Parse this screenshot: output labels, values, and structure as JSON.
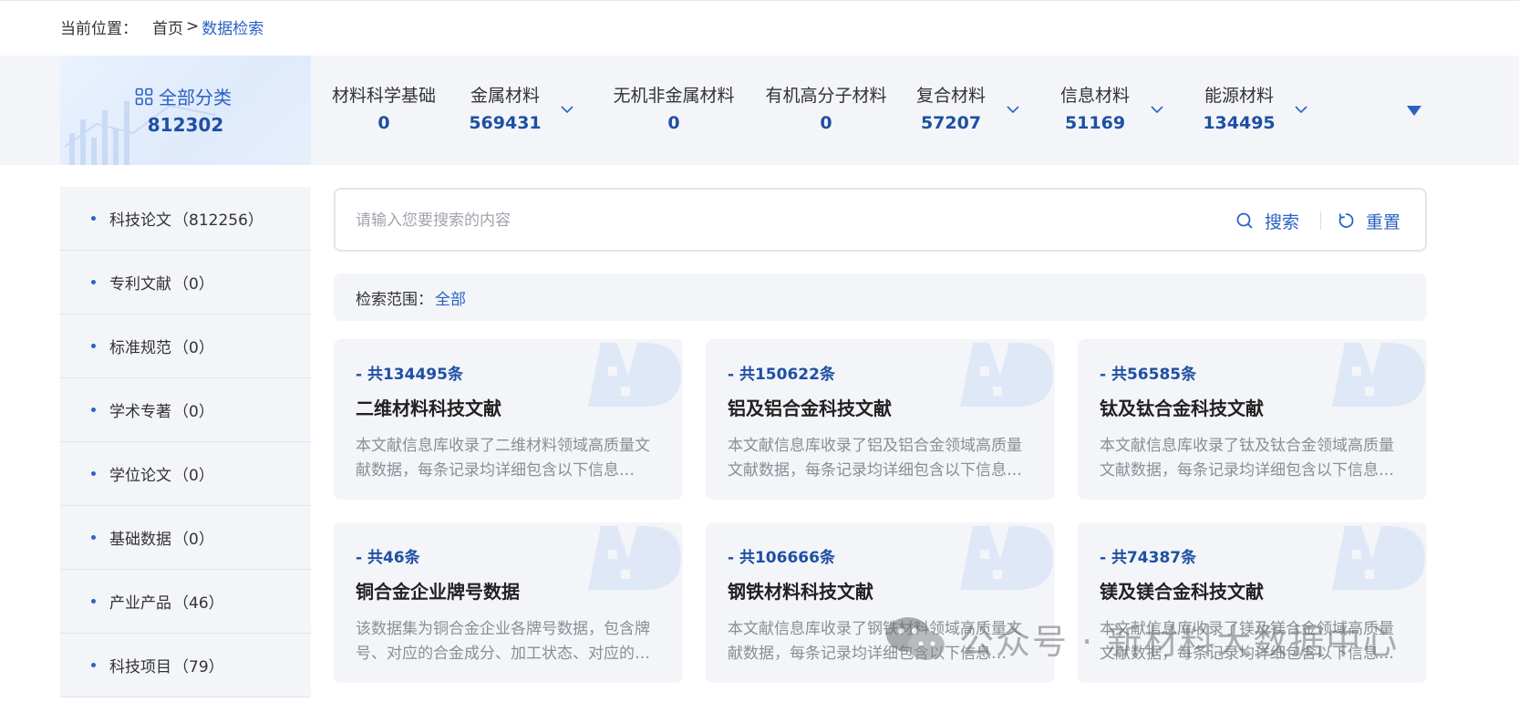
{
  "breadcrumb": {
    "prefix": "当前位置：",
    "home": "首页",
    "sep": ">",
    "current": "数据检索"
  },
  "all_category": {
    "label": "全部分类",
    "count": "812302"
  },
  "categories": [
    {
      "name": "材料科学基础",
      "count": "0",
      "has_dropdown": false
    },
    {
      "name": "金属材料",
      "count": "569431",
      "has_dropdown": true
    },
    {
      "name": "无机非金属材料",
      "count": "0",
      "has_dropdown": false
    },
    {
      "name": "有机高分子材料",
      "count": "0",
      "has_dropdown": false
    },
    {
      "name": "复合材料",
      "count": "57207",
      "has_dropdown": true
    },
    {
      "name": "信息材料",
      "count": "51169",
      "has_dropdown": true
    },
    {
      "name": "能源材料",
      "count": "134495",
      "has_dropdown": true
    }
  ],
  "sidebar": {
    "items": [
      {
        "label": "科技论文",
        "count": "（812256）"
      },
      {
        "label": "专利文献",
        "count": "（0）"
      },
      {
        "label": "标准规范",
        "count": "（0）"
      },
      {
        "label": "学术专著",
        "count": "（0）"
      },
      {
        "label": "学位论文",
        "count": "（0）"
      },
      {
        "label": "基础数据",
        "count": "（0）"
      },
      {
        "label": "产业产品",
        "count": "（46）"
      },
      {
        "label": "科技项目",
        "count": "（79）"
      }
    ]
  },
  "search": {
    "placeholder": "请输入您要搜索的内容",
    "search_label": "搜索",
    "reset_label": "重置"
  },
  "scope": {
    "label": "检索范围：",
    "value": "全部"
  },
  "cards": [
    {
      "total": "- 共134495条",
      "title": "二维材料科技文献",
      "desc": "本文献信息库收录了二维材料领域高质量文献数据，每条记录均详细包含以下信息…"
    },
    {
      "total": "- 共150622条",
      "title": "铝及铝合金科技文献",
      "desc": "本文献信息库收录了铝及铝合金领域高质量文献数据，每条记录均详细包含以下信息…"
    },
    {
      "total": "- 共56585条",
      "title": "钛及钛合金科技文献",
      "desc": "本文献信息库收录了钛及钛合金领域高质量文献数据，每条记录均详细包含以下信息…"
    },
    {
      "total": "- 共46条",
      "title": "铜合金企业牌号数据",
      "desc": "该数据集为铜合金企业各牌号数据，包含牌号、对应的合金成分、加工状态、对应的…"
    },
    {
      "total": "- 共106666条",
      "title": "钢铁材料科技文献",
      "desc": "本文献信息库收录了钢铁材料领域高质量文献数据，每条记录均详细包含以下信息…"
    },
    {
      "total": "- 共74387条",
      "title": "镁及镁合金科技文献",
      "desc": "本文献信息库收录了镁及镁合金领域高质量文献数据，每条记录均详细包含以下信息…"
    }
  ],
  "watermark_text": "公众号 · 新材料大数据中心",
  "colors": {
    "accent": "#2a62c3",
    "accent_dark": "#1f4fa3",
    "panel": "#f3f5f9"
  }
}
